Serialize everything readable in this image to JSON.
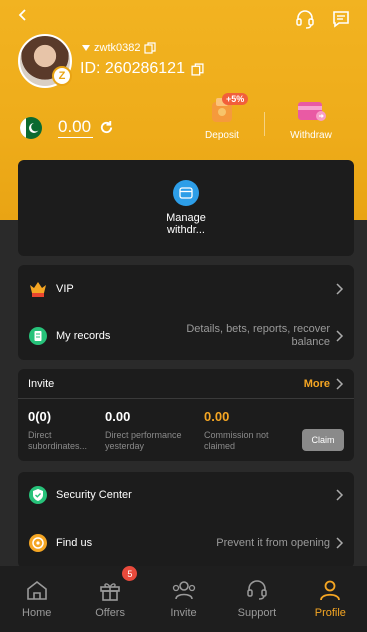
{
  "header": {
    "username": "zwtk0382",
    "id_text": "ID: 260286121",
    "avatar_badge": "Z",
    "balance": "0.00",
    "deposit_label": "Deposit",
    "deposit_bonus": "+5%",
    "withdraw_label": "Withdraw"
  },
  "manage": {
    "label": "Manage withdr..."
  },
  "menu1": {
    "vip_label": "VIP",
    "records_label": "My records",
    "records_hint": "Details, bets, reports, recover balance"
  },
  "invite": {
    "title": "Invite",
    "more": "More",
    "stat1_value": "0(0)",
    "stat1_desc": "Direct subordinates...",
    "stat2_value": "0.00",
    "stat2_desc": "Direct performance yesterday",
    "stat3_value": "0.00",
    "stat3_desc": "Commission not claimed",
    "claim": "Claim"
  },
  "menu2": {
    "security_label": "Security Center",
    "findus_label": "Find us",
    "findus_hint": "Prevent it from opening"
  },
  "nav": {
    "items": [
      {
        "label": "Home",
        "icon": "home-icon"
      },
      {
        "label": "Offers",
        "icon": "gift-icon",
        "badge": "5"
      },
      {
        "label": "Invite",
        "icon": "people-icon"
      },
      {
        "label": "Support",
        "icon": "headset-icon"
      },
      {
        "label": "Profile",
        "icon": "person-icon",
        "active": true
      }
    ]
  },
  "colors": {
    "accent": "#f5a623",
    "header": "#f2b321",
    "card": "#1c1c1c"
  }
}
